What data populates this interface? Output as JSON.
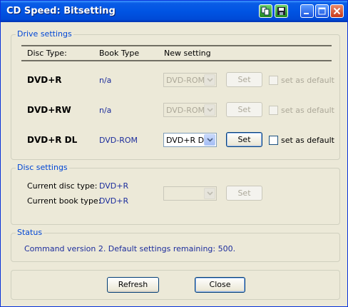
{
  "window": {
    "title": "CD Speed: Bitsetting",
    "title_icons": [
      "copy-icon",
      "save-icon",
      "minimize-icon",
      "maximize-icon",
      "close-icon"
    ]
  },
  "drive_settings": {
    "legend": "Drive settings",
    "headers": {
      "disc_type": "Disc Type:",
      "book_type": "Book Type",
      "new_setting": "New setting"
    },
    "rows": [
      {
        "disc": "DVD+R",
        "book": "n/a",
        "setting": "DVD-ROM",
        "set_label": "Set",
        "default_label": "set as default",
        "enabled": false
      },
      {
        "disc": "DVD+RW",
        "book": "n/a",
        "setting": "DVD-ROM",
        "set_label": "Set",
        "default_label": "set as default",
        "enabled": false
      },
      {
        "disc": "DVD+R DL",
        "book": "DVD-ROM",
        "setting": "DVD+R DL",
        "set_label": "Set",
        "default_label": "set as default",
        "enabled": true
      }
    ]
  },
  "disc_settings": {
    "legend": "Disc settings",
    "current_disc_label": "Current disc type:",
    "current_disc_value": "DVD+R",
    "current_book_label": "Current book type:",
    "current_book_value": "DVD+R",
    "set_label": "Set"
  },
  "status": {
    "legend": "Status",
    "text": "Command version 2. Default settings remaining: 500."
  },
  "buttons": {
    "refresh": "Refresh",
    "close": "Close"
  },
  "colors": {
    "titlebar": "#0054e3",
    "legend": "#0046d5",
    "value_text": "#1c2d9c",
    "face": "#ece9d8"
  }
}
